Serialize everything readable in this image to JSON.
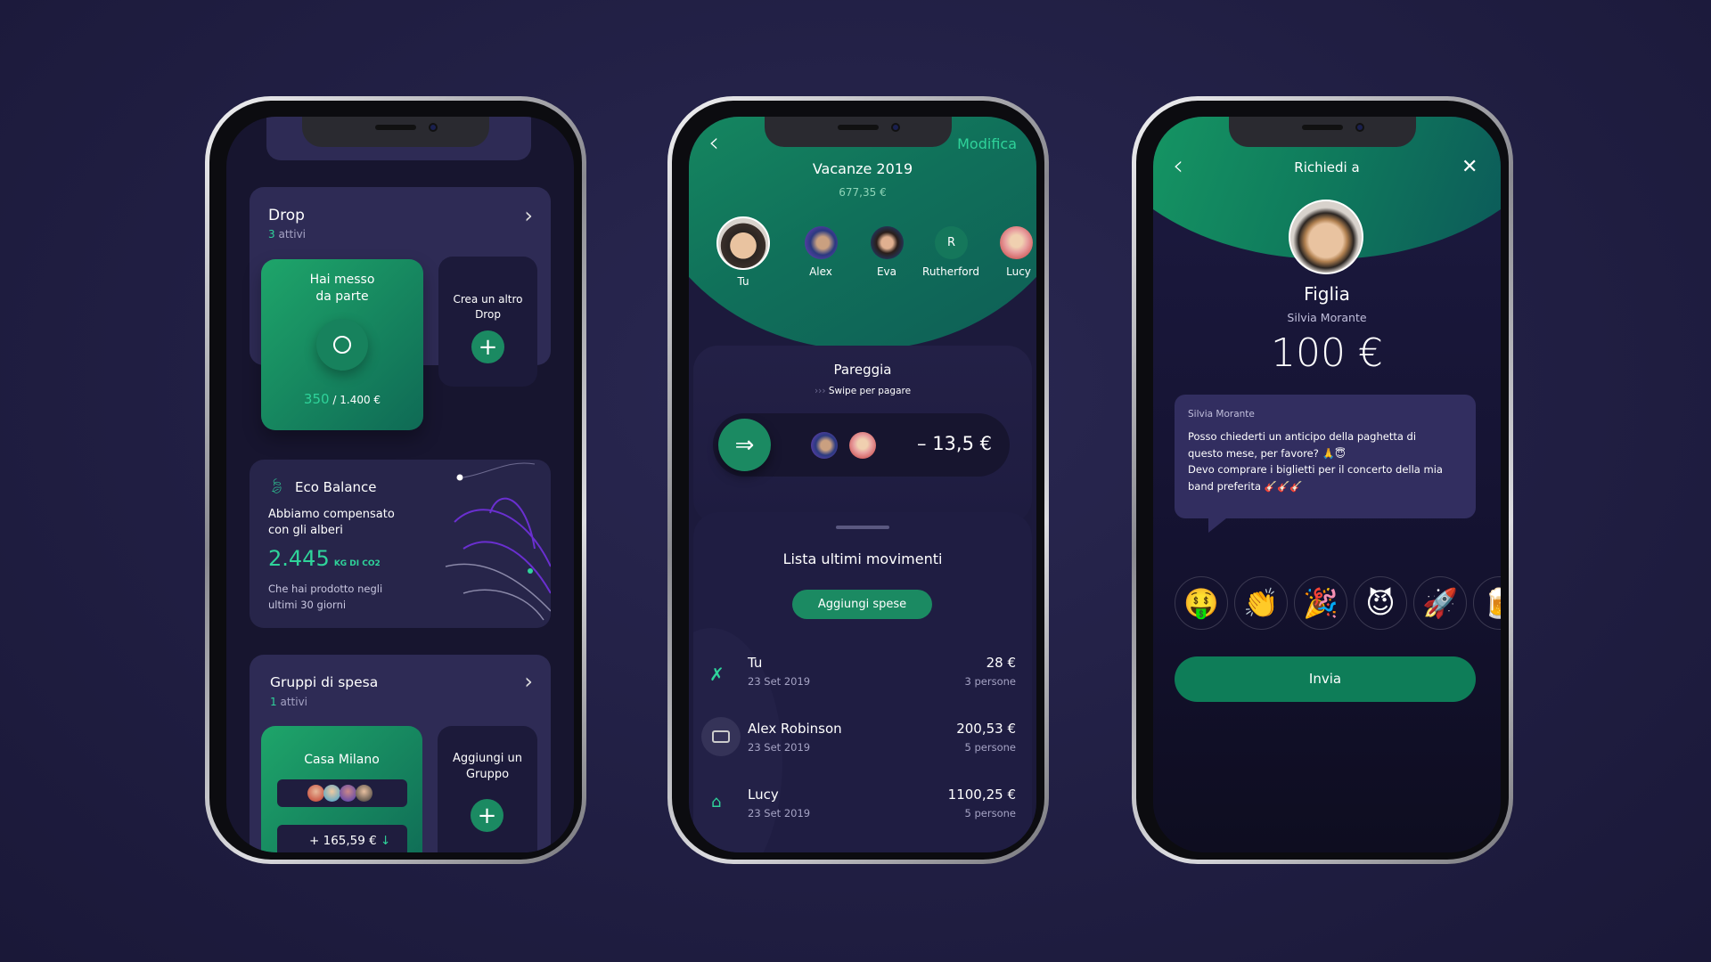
{
  "phone1": {
    "drop": {
      "title": "Drop",
      "count": "3",
      "count_label": "attivi",
      "saved_card": {
        "title_line1": "Hai messo",
        "title_line2": "da parte",
        "current": "350",
        "target": "/ 1.400 €"
      },
      "create_card": {
        "line1": "Crea un altro",
        "line2": "Drop"
      }
    },
    "eco": {
      "title": "Eco Balance",
      "line1": "Abbiamo compensato",
      "line2": "con gli alberi",
      "value": "2.445",
      "unit": "KG DI CO2",
      "foot1": "Che hai prodotto negli",
      "foot2": "ultimi 30 giorni"
    },
    "groups": {
      "title": "Gruppi di spesa",
      "count": "1",
      "count_label": "attivi",
      "group_card": {
        "name": "Casa Milano",
        "amount": "+ 165,59 €"
      },
      "add_card": {
        "line1": "Aggiungi un",
        "line2": "Gruppo"
      }
    }
  },
  "phone2": {
    "edit_label": "Modifica",
    "title": "Vacanze 2019",
    "total": "677,35 €",
    "members": [
      {
        "name": "Tu"
      },
      {
        "name": "Alex"
      },
      {
        "name": "Eva"
      },
      {
        "name": "Rutherford",
        "initial": "R"
      },
      {
        "name": "Lucy"
      }
    ],
    "settle": {
      "title": "Pareggia",
      "hint": "Swipe per pagare",
      "amount": "– 13,5 €"
    },
    "movements": {
      "title": "Lista ultimi movimenti",
      "add_label": "Aggiungi spese",
      "rows": [
        {
          "name": "Tu",
          "date": "23 Set 2019",
          "amount": "28 €",
          "people": "3 persone",
          "icon": "cutlery-icon"
        },
        {
          "name": "Alex Robinson",
          "date": "23 Set 2019",
          "amount": "200,53 €",
          "people": "5 persone",
          "icon": "card-icon"
        },
        {
          "name": "Lucy",
          "date": "23 Set 2019",
          "amount": "1100,25 €",
          "people": "5 persone",
          "icon": "home-icon"
        }
      ]
    }
  },
  "phone3": {
    "title": "Richiedi a",
    "relation": "Figlia",
    "name": "Silvia Morante",
    "amount": "100 €",
    "message": {
      "sender": "Silvia Morante",
      "line1": "Posso chiederti un anticipo della paghetta di",
      "line2": "questo mese, per favore? 🙏😇",
      "line3": "Devo comprare i biglietti per il concerto della mia",
      "line4": "band preferita 🎸🎸🎸"
    },
    "reactions": [
      "🤑",
      "👏",
      "🎉",
      "😈",
      "🚀",
      "🍺"
    ],
    "send_label": "Invia"
  },
  "colors": {
    "accent": "#1b8a62",
    "mint": "#2fd39a",
    "background": "#201e42",
    "card": "#2e2b55"
  }
}
